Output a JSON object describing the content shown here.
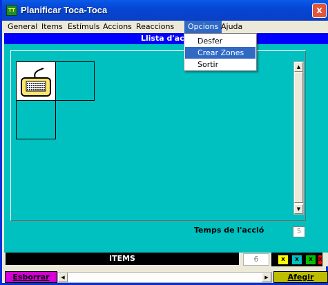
{
  "window": {
    "title": "Planificar Toca-Toca",
    "icon_text": "TT",
    "close_label": "x"
  },
  "menubar": {
    "items": [
      {
        "label": "General"
      },
      {
        "label": "Items"
      },
      {
        "label": "Estímuls"
      },
      {
        "label": "Accions"
      },
      {
        "label": "Reaccions"
      },
      {
        "label": "Opcions"
      },
      {
        "label": "Ajuda"
      }
    ],
    "active": "Opcions"
  },
  "dropdown": {
    "items": [
      {
        "label": "Desfer",
        "highlighted": false
      },
      {
        "label": "Crear Zones",
        "highlighted": true
      },
      {
        "label": "Sortir",
        "highlighted": false
      }
    ]
  },
  "main": {
    "header": "Llista d'acci",
    "time_label": "Temps de l'acció",
    "time_value": "5",
    "scroll_up": "▲",
    "scroll_down": "▼"
  },
  "items_bar": {
    "label": "ITEMS",
    "count": "6",
    "color_boxes": [
      {
        "label": "x",
        "color": "#ffff00"
      },
      {
        "label": "x",
        "color": "#00c0c0"
      },
      {
        "label": "x",
        "color": "#00c000"
      },
      {
        "label": "x",
        "color": "#ff0000"
      }
    ]
  },
  "bottom_bar": {
    "erase_label": "Esborrar",
    "add_label": "Afegir",
    "scroll_left": "◀",
    "scroll_right": "▶"
  },
  "colors": {
    "canvas": "#00c0c0",
    "header": "#0000ff",
    "erase": "#d400d4",
    "add": "#bcbc00"
  },
  "icons": [
    "keyboard-icon",
    "app-icon",
    "close-icon"
  ]
}
